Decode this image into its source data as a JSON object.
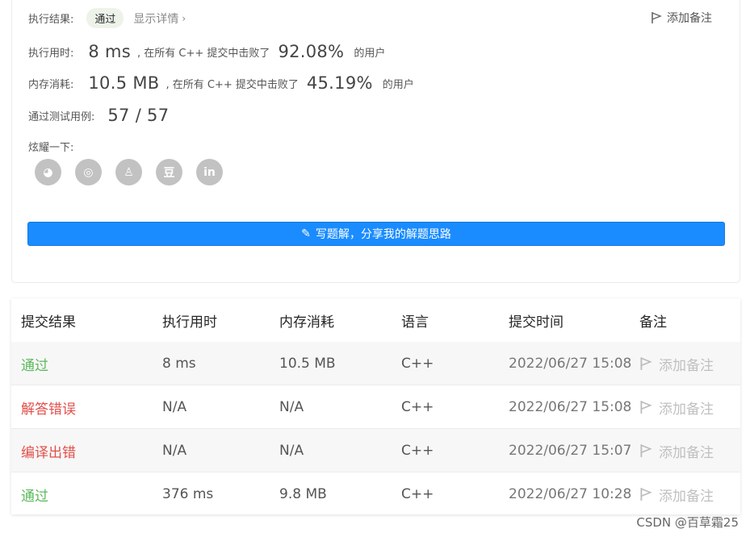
{
  "result": {
    "exec_label": "执行结果:",
    "status_chip": "通过",
    "details_link": "显示详情",
    "add_note": "添加备注",
    "runtime_label": "执行用时:",
    "runtime_value": "8 ms",
    "runtime_mid": ", 在所有 C++ 提交中击败了",
    "runtime_percent": "92.08%",
    "runtime_suffix": "的用户",
    "memory_label": "内存消耗:",
    "memory_value": "10.5 MB",
    "memory_mid": ", 在所有 C++ 提交中击败了",
    "memory_percent": "45.19%",
    "memory_suffix": "的用户",
    "tests_label": "通过测试用例:",
    "tests_value": "57 / 57",
    "share_label": "炫耀一下:",
    "share_icons": [
      "wechat-icon",
      "weibo-icon",
      "qq-icon",
      "douban-icon",
      "linkedin-icon"
    ],
    "share_glyphs": [
      "◕",
      "◎",
      "♙",
      "豆",
      "in"
    ],
    "write_button": "写题解，分享我的解题思路"
  },
  "table": {
    "headers": [
      "提交结果",
      "执行用时",
      "内存消耗",
      "语言",
      "提交时间",
      "备注"
    ],
    "rows": [
      {
        "status": "通过",
        "status_type": "ok",
        "runtime": "8 ms",
        "memory": "10.5 MB",
        "lang": "C++",
        "time": "2022/06/27 15:08",
        "note": "添加备注"
      },
      {
        "status": "解答错误",
        "status_type": "err",
        "runtime": "N/A",
        "memory": "N/A",
        "lang": "C++",
        "time": "2022/06/27 15:08",
        "note": "添加备注"
      },
      {
        "status": "编译出错",
        "status_type": "err",
        "runtime": "N/A",
        "memory": "N/A",
        "lang": "C++",
        "time": "2022/06/27 15:07",
        "note": "添加备注"
      },
      {
        "status": "通过",
        "status_type": "ok",
        "runtime": "376 ms",
        "memory": "9.8 MB",
        "lang": "C++",
        "time": "2022/06/27 10:28",
        "note": "添加备注"
      }
    ]
  },
  "watermark": "CSDN @百草霜25",
  "colors": {
    "accent": "#1a8cff",
    "pass": "#5cb85c",
    "error": "#e0504b"
  }
}
